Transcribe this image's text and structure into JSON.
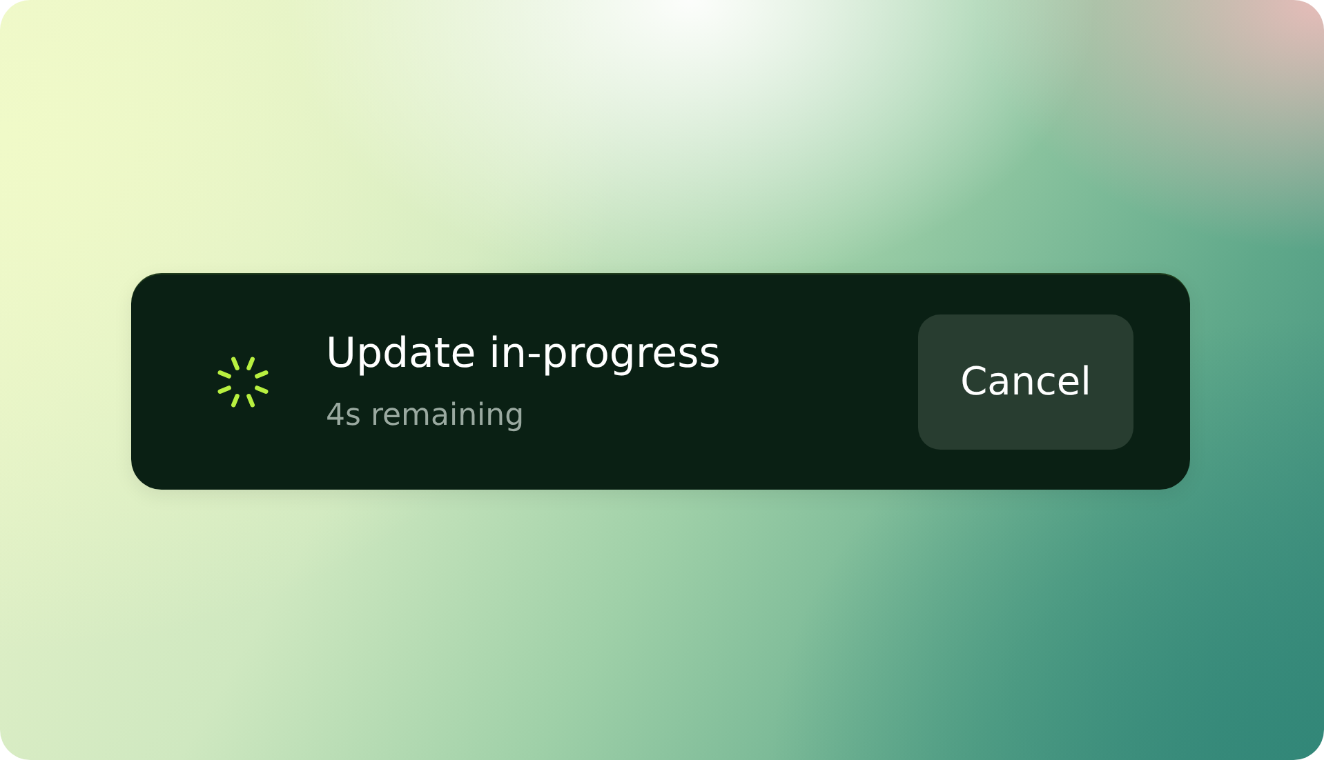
{
  "toast": {
    "title": "Update in-progress",
    "subtitle": "4s remaining",
    "button": "Cancel",
    "loading": true
  }
}
